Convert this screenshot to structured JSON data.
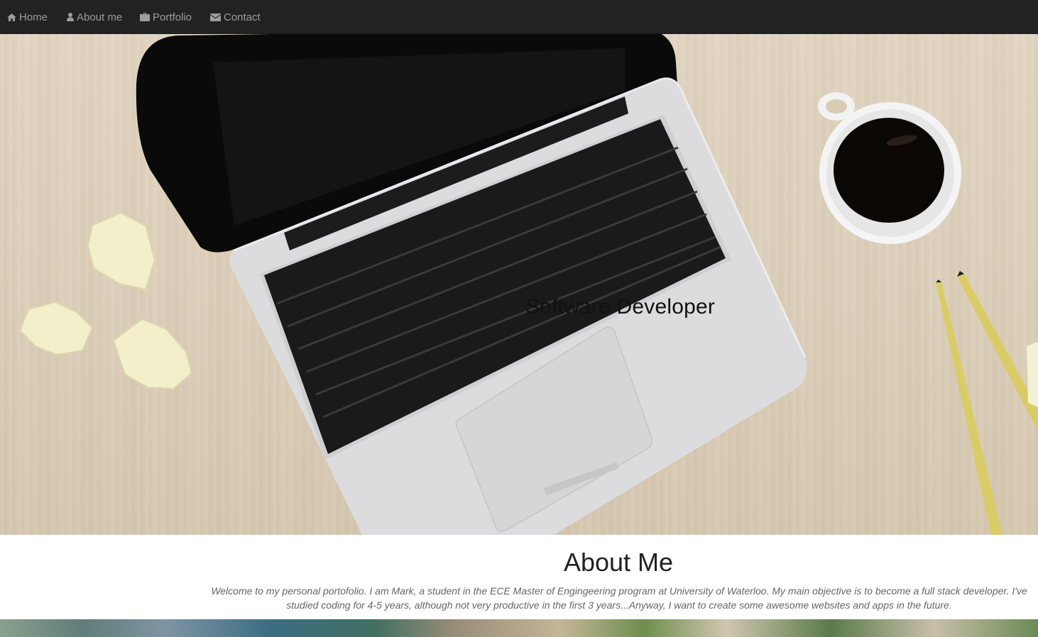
{
  "nav": {
    "items": [
      {
        "label": "Home",
        "icon": "home-icon"
      },
      {
        "label": "About me",
        "icon": "user-icon"
      },
      {
        "label": "Portfolio",
        "icon": "briefcase-icon"
      },
      {
        "label": "Contact",
        "icon": "envelope-icon"
      }
    ]
  },
  "hero": {
    "title": "Software Developer"
  },
  "about": {
    "title": "About Me",
    "text": "Welcome to my personal portofolio. I am Mark, a student in the ECE Master of Engingeering program at University of Waterloo. My main objective is to become a full stack developer. I've studied coding for 4-5 years, although not very productive in the first 3 years...Anyway, I want to create some awesome websites and apps in the future."
  },
  "colors": {
    "navbar_bg": "#222222",
    "nav_text": "#9d9d9d",
    "heading": "#222222",
    "body_text": "#666666"
  }
}
